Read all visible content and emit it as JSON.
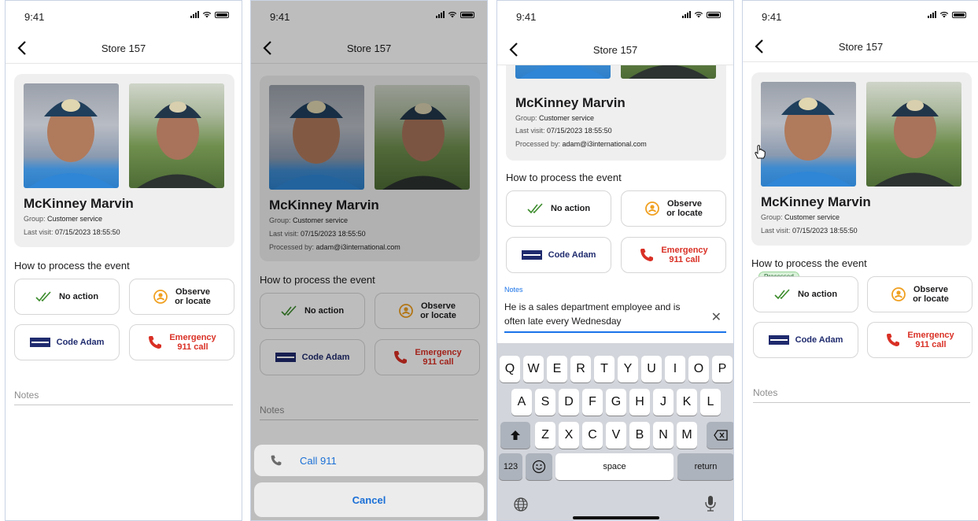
{
  "status": {
    "time": "9:41"
  },
  "nav": {
    "title": "Store 157"
  },
  "person": {
    "name": "McKinney Marvin",
    "group_label": "Group:",
    "group": "Customer service",
    "last_visit_label": "Last visit:",
    "last_visit": "07/15/2023 18:55:50",
    "processed_by_label": "Processed by:",
    "processed_by": "adam@i3international.com"
  },
  "process": {
    "title": "How to process the event",
    "no_action": "No action",
    "observe_l1": "Observe",
    "observe_l2": "or locate",
    "code_adam": "Code Adam",
    "emergency_l1": "Emergency",
    "emergency_l2": "911 call",
    "processed_badge": "Processed"
  },
  "notes": {
    "label": "Notes",
    "value": "He is a sales department employee and is often late every Wednesday"
  },
  "action_sheet": {
    "call": "Call 911",
    "cancel": "Cancel"
  },
  "keyboard": {
    "row1": [
      "Q",
      "W",
      "E",
      "R",
      "T",
      "Y",
      "U",
      "I",
      "O",
      "P"
    ],
    "row2": [
      "A",
      "S",
      "D",
      "F",
      "G",
      "H",
      "J",
      "K",
      "L"
    ],
    "row3": [
      "Z",
      "X",
      "C",
      "V",
      "B",
      "N",
      "M"
    ],
    "num": "123",
    "space": "space",
    "return": "return"
  },
  "colors": {
    "accent": "#1a73e8",
    "danger": "#d93025",
    "observe": "#f0a020",
    "adam_blue": "#1f2b6e",
    "check_green": "#3c8c2c"
  }
}
